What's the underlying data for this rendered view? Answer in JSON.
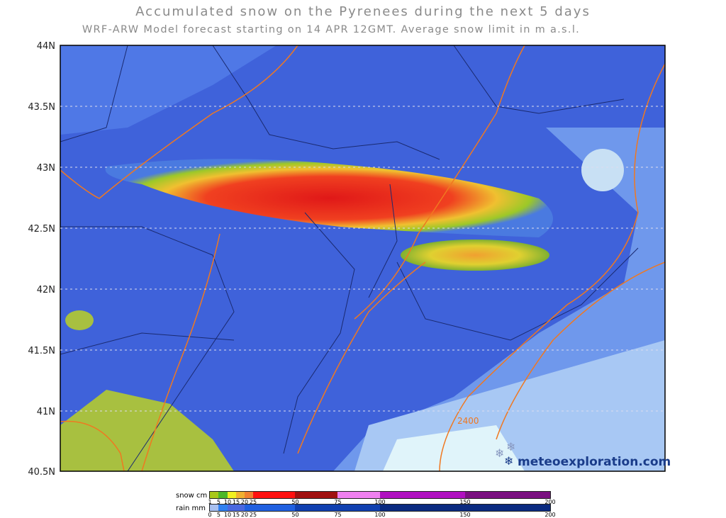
{
  "header": {
    "title": "Accumulated snow on the Pyrenees during the next 5 days",
    "subtitle": "WRF-ARW Model forecast starting on 14 APR 12GMT.  Average snow limit in m a.s.l."
  },
  "map": {
    "lat_labels": [
      "44N",
      "43.5N",
      "43N",
      "42.5N",
      "42N",
      "41.5N",
      "41N",
      "40.5N"
    ],
    "contour_label": "2400",
    "watermark": "meteoexploration.com",
    "colors": {
      "sea_land_base": "#3b5fd8",
      "contour": "#f07820",
      "border": "#1a2a70"
    }
  },
  "legend": {
    "snow_label": "snow cm",
    "rain_label": "rain mm",
    "snow_ticks": [
      "1",
      "5",
      "10",
      "15",
      "20",
      "25",
      "50",
      "75",
      "100",
      "150",
      "200"
    ],
    "rain_ticks": [
      "0",
      "5",
      "10",
      "15",
      "20",
      "25",
      "50",
      "75",
      "100",
      "150",
      "200"
    ],
    "snow_colors": [
      "#a8c81a",
      "#4cb828",
      "#f0f020",
      "#f0b030",
      "#f08030",
      "#ff1010",
      "#a01010",
      "#f080f0",
      "#b010c0",
      "#7a1080"
    ],
    "rain_colors": [
      "#a8c0f0",
      "#3080f0",
      "#4a68e0",
      "#2060e0",
      "#1040b0",
      "#0a2a80"
    ]
  }
}
